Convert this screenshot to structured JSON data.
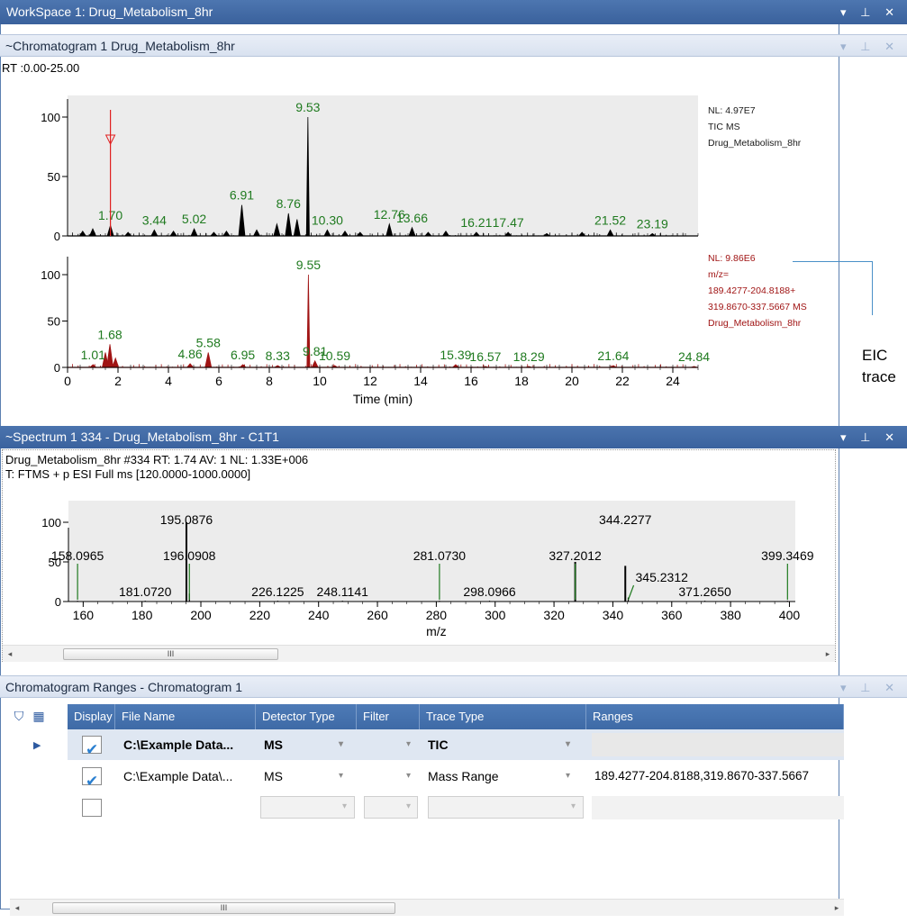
{
  "workspace": {
    "title": "WorkSpace 1: Drug_Metabolism_8hr",
    "controls": "▾ ⊥ ✕"
  },
  "chromatogram": {
    "title": "~Chromatogram  1  Drug_Metabolism_8hr",
    "rt_range": "RT :0.00-25.00",
    "traces": [
      {
        "id": "tic",
        "color": "#000000",
        "labels": [
          "NL: 4.97E7",
          "TIC  MS",
          "Drug_Metabolism_8hr"
        ],
        "label_color": "#1b1b1b",
        "peaks": [
          {
            "x": 0.6,
            "y": 4
          },
          {
            "x": 1.0,
            "y": 6
          },
          {
            "x": 1.7,
            "y": 9
          },
          {
            "x": 2.4,
            "y": 3
          },
          {
            "x": 3.44,
            "y": 5
          },
          {
            "x": 4.2,
            "y": 4
          },
          {
            "x": 5.02,
            "y": 6
          },
          {
            "x": 5.8,
            "y": 3
          },
          {
            "x": 6.3,
            "y": 4
          },
          {
            "x": 6.91,
            "y": 26
          },
          {
            "x": 7.5,
            "y": 5
          },
          {
            "x": 8.3,
            "y": 10
          },
          {
            "x": 8.76,
            "y": 19
          },
          {
            "x": 9.1,
            "y": 14
          },
          {
            "x": 9.53,
            "y": 100
          },
          {
            "x": 10.3,
            "y": 5
          },
          {
            "x": 11.0,
            "y": 4
          },
          {
            "x": 11.6,
            "y": 3
          },
          {
            "x": 12.76,
            "y": 10
          },
          {
            "x": 13.66,
            "y": 7
          },
          {
            "x": 14.3,
            "y": 3
          },
          {
            "x": 15.0,
            "y": 4
          },
          {
            "x": 16.21,
            "y": 3
          },
          {
            "x": 17.47,
            "y": 3
          },
          {
            "x": 19.0,
            "y": 2
          },
          {
            "x": 20.4,
            "y": 3
          },
          {
            "x": 21.52,
            "y": 5
          },
          {
            "x": 23.19,
            "y": 2
          }
        ],
        "peak_labels": [
          {
            "text": "1.70",
            "x": 1.7
          },
          {
            "text": "3.44",
            "x": 3.44
          },
          {
            "text": "5.02",
            "x": 5.02
          },
          {
            "text": "6.91",
            "x": 6.91
          },
          {
            "text": "8.76",
            "x": 8.76
          },
          {
            "text": "9.53",
            "x": 9.53
          },
          {
            "text": "10.30",
            "x": 10.3
          },
          {
            "text": "12.76",
            "x": 12.76
          },
          {
            "text": "13.66",
            "x": 13.66
          },
          {
            "text": "16.21",
            "x": 16.21
          },
          {
            "text": "17.47",
            "x": 17.47
          },
          {
            "text": "21.52",
            "x": 21.52
          },
          {
            "text": "23.19",
            "x": 23.19
          }
        ],
        "marker_rt": 1.7
      },
      {
        "id": "eic",
        "color": "#a01414",
        "labels": [
          "NL: 9.86E6",
          "m/z=",
          "189.4277-204.8188+",
          "319.8670-337.5667 MS",
          "Drug_Metabolism_8hr"
        ],
        "label_color": "#a01414",
        "peaks": [
          {
            "x": 1.01,
            "y": 3
          },
          {
            "x": 1.5,
            "y": 16
          },
          {
            "x": 1.68,
            "y": 25
          },
          {
            "x": 1.9,
            "y": 10
          },
          {
            "x": 4.86,
            "y": 4
          },
          {
            "x": 5.58,
            "y": 16
          },
          {
            "x": 6.95,
            "y": 3
          },
          {
            "x": 8.33,
            "y": 2
          },
          {
            "x": 9.55,
            "y": 100
          },
          {
            "x": 9.81,
            "y": 7
          },
          {
            "x": 10.59,
            "y": 2
          },
          {
            "x": 15.39,
            "y": 3
          },
          {
            "x": 16.57,
            "y": 1
          },
          {
            "x": 18.29,
            "y": 1
          },
          {
            "x": 21.64,
            "y": 2
          },
          {
            "x": 24.84,
            "y": 1
          }
        ],
        "peak_labels": [
          {
            "text": "1.01",
            "x": 1.01
          },
          {
            "text": "1.68",
            "x": 1.68
          },
          {
            "text": "4.86",
            "x": 4.86
          },
          {
            "text": "5.58",
            "x": 5.58
          },
          {
            "text": "6.95",
            "x": 6.95
          },
          {
            "text": "8.33",
            "x": 8.33
          },
          {
            "text": "9.55",
            "x": 9.55
          },
          {
            "text": "9.81",
            "x": 9.81
          },
          {
            "text": "10.59",
            "x": 10.59
          },
          {
            "text": "15.39",
            "x": 15.39
          },
          {
            "text": "16.57",
            "x": 16.57
          },
          {
            "text": "18.29",
            "x": 18.29
          },
          {
            "text": "21.64",
            "x": 21.64
          },
          {
            "text": "24.84",
            "x": 24.84
          }
        ]
      }
    ],
    "x_axis_label": "Time (min)",
    "x_ticks": [
      "0",
      "2",
      "4",
      "6",
      "8",
      "10",
      "12",
      "14",
      "16",
      "18",
      "20",
      "22",
      "24"
    ],
    "y_ticks": [
      "0",
      "50",
      "100"
    ]
  },
  "annotation": {
    "line1": "EIC",
    "line2": "trace"
  },
  "spectrum": {
    "title": "~Spectrum  1  334 - Drug_Metabolism_8hr - C1T1",
    "info_line1": "Drug_Metabolism_8hr #334 RT: 1.74 AV: 1 NL: 1.33E+006",
    "info_line2": "T: FTMS + p ESI Full ms [120.0000-1000.0000]",
    "x_axis_label": "m/z",
    "x_ticks": [
      "160",
      "180",
      "200",
      "220",
      "240",
      "260",
      "280",
      "300",
      "320",
      "340",
      "360",
      "380",
      "400"
    ],
    "y_ticks": [
      "0",
      "50",
      "100"
    ]
  },
  "chart_data": [
    {
      "type": "line",
      "title": "RT :0.00-25.00",
      "xlabel": "Time (min)",
      "ylabel": "",
      "xlim": [
        0,
        25
      ],
      "ylim": [
        0,
        100
      ],
      "series": [
        {
          "name": "TIC MS Drug_Metabolism_8hr",
          "x": [
            1.7,
            3.44,
            5.02,
            6.91,
            8.76,
            9.53,
            10.3,
            12.76,
            13.66,
            16.21,
            17.47,
            21.52,
            23.19
          ],
          "y": [
            9,
            5,
            6,
            26,
            19,
            100,
            5,
            10,
            7,
            3,
            3,
            5,
            2
          ]
        },
        {
          "name": "m/z= 189.4277-204.8188+ 319.8670-337.5667 MS Drug_Metabolism_8hr",
          "x": [
            1.01,
            1.68,
            4.86,
            5.58,
            6.95,
            8.33,
            9.55,
            9.81,
            10.59,
            15.39,
            16.57,
            18.29,
            21.64,
            24.84
          ],
          "y": [
            3,
            25,
            4,
            16,
            3,
            2,
            100,
            7,
            2,
            3,
            1,
            1,
            2,
            1
          ]
        }
      ]
    },
    {
      "type": "bar",
      "title": "Drug_Metabolism_8hr #334 RT: 1.74 AV: 1 NL: 1.33E+006",
      "xlabel": "m/z",
      "ylabel": "",
      "xlim": [
        155,
        402
      ],
      "ylim": [
        0,
        100
      ],
      "series": [
        {
          "name": "",
          "x": [
            158.0965,
            181.072,
            195.0876,
            196.0908,
            226.1225,
            248.1141,
            281.073,
            298.0966,
            327.2012,
            344.2277,
            345.2312,
            371.265,
            399.3469
          ],
          "y": [
            1,
            1,
            100,
            10,
            1,
            1,
            1,
            1,
            50,
            45,
            5,
            1,
            1
          ]
        }
      ],
      "peak_labels": [
        {
          "text": "158.0965",
          "x": 158.0965,
          "pos": "upper"
        },
        {
          "text": "181.0720",
          "x": 181.072,
          "pos": "lower"
        },
        {
          "text": "195.0876",
          "x": 195.0876,
          "pos": "top"
        },
        {
          "text": "196.0908",
          "x": 196.0908,
          "pos": "upper"
        },
        {
          "text": "226.1225",
          "x": 226.1225,
          "pos": "lower"
        },
        {
          "text": "248.1141",
          "x": 248.1141,
          "pos": "lower"
        },
        {
          "text": "281.0730",
          "x": 281.073,
          "pos": "upper"
        },
        {
          "text": "298.0966",
          "x": 298.0966,
          "pos": "lower"
        },
        {
          "text": "327.2012",
          "x": 327.2012,
          "pos": "upper"
        },
        {
          "text": "344.2277",
          "x": 344.2277,
          "pos": "top"
        },
        {
          "text": "345.2312",
          "x": 345.2312,
          "pos": "mid"
        },
        {
          "text": "371.2650",
          "x": 371.265,
          "pos": "lower"
        },
        {
          "text": "399.3469",
          "x": 399.3469,
          "pos": "upper"
        }
      ]
    }
  ],
  "ranges": {
    "title": "Chromatogram Ranges  - Chromatogram 1",
    "columns": [
      "Display",
      "File Name",
      "Detector Type",
      "Filter",
      "Trace Type",
      "Ranges"
    ],
    "rows": [
      {
        "selected": true,
        "display": true,
        "file": "C:\\Example Data...",
        "detector": "MS",
        "filter": "",
        "trace": "TIC",
        "ranges": "",
        "bold": true
      },
      {
        "selected": false,
        "display": true,
        "file": "C:\\Example Data\\...",
        "detector": "MS",
        "filter": "",
        "trace": "Mass Range",
        "ranges": "189.4277-204.8188,319.8670-337.5667",
        "bold": false
      },
      {
        "selected": false,
        "display": false,
        "file": "",
        "detector": "",
        "filter": "",
        "trace": "",
        "ranges": "",
        "bold": false
      }
    ],
    "scroll_thumb": "III"
  },
  "colors": {
    "title_blue": "#3f68a4",
    "peak_label_green": "#1f7a1f",
    "tic": "#000000",
    "eic": "#a01414",
    "plot_bg": "#ececec"
  }
}
